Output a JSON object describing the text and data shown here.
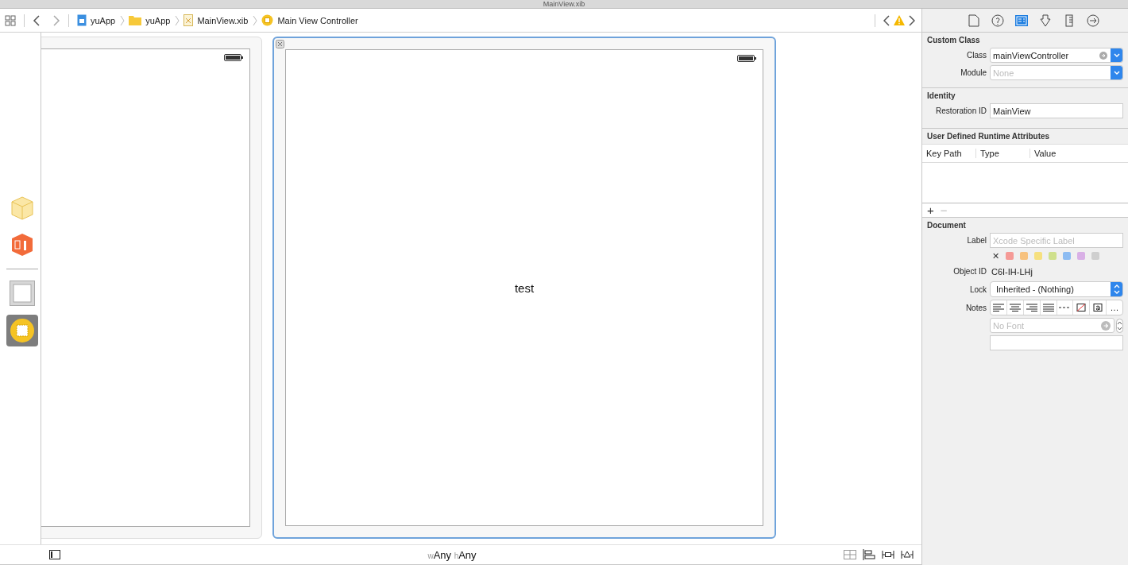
{
  "window": {
    "title": "MainView.xib"
  },
  "jump_bar": [
    {
      "label": "yuApp",
      "kind": "project"
    },
    {
      "label": "yuApp",
      "kind": "folder"
    },
    {
      "label": "MainView.xib",
      "kind": "xib"
    },
    {
      "label": "Main View Controller",
      "kind": "controller"
    }
  ],
  "outline": [
    {
      "kind": "cube",
      "selected": false
    },
    {
      "kind": "responder",
      "selected": false
    },
    {
      "kind": "view",
      "selected": false
    },
    {
      "kind": "controller",
      "selected": true
    }
  ],
  "canvas": {
    "label": "test"
  },
  "size_class": {
    "w_prefix": "w",
    "w_value": "Any",
    "h_prefix": "h",
    "h_value": "Any"
  },
  "inspector_tabs": [
    {
      "kind": "file",
      "selected": false
    },
    {
      "kind": "help",
      "selected": false
    },
    {
      "kind": "identity",
      "selected": true
    },
    {
      "kind": "attributes",
      "selected": false
    },
    {
      "kind": "size",
      "selected": false
    },
    {
      "kind": "connections",
      "selected": false
    }
  ],
  "custom_class": {
    "title": "Custom Class",
    "class_label": "Class",
    "class_value": "mainViewController",
    "module_label": "Module",
    "module_placeholder": "None"
  },
  "identity": {
    "title": "Identity",
    "restoration_label": "Restoration ID",
    "restoration_value": "MainView"
  },
  "runtime_attributes": {
    "title": "User Defined Runtime Attributes",
    "columns": [
      "Key Path",
      "Type",
      "Value"
    ],
    "add": "+",
    "remove": "−"
  },
  "document": {
    "title": "Document",
    "label_label": "Label",
    "label_placeholder": "Xcode Specific Label",
    "clear": "✕",
    "label_colors": [
      {
        "color": "#f59a96"
      },
      {
        "color": "#f7c27f"
      },
      {
        "color": "#f6e07e"
      },
      {
        "color": "#cfe08c"
      },
      {
        "color": "#8dbcf2"
      },
      {
        "color": "#d9b0e6"
      },
      {
        "color": "#cfcfcf"
      }
    ],
    "object_id_label": "Object ID",
    "object_id": "C6I-IH-LHj",
    "lock_label": "Lock",
    "lock_value": "Inherited - (Nothing)",
    "notes_label": "Notes",
    "notes_tools": [
      {
        "kind": "left"
      },
      {
        "kind": "center"
      },
      {
        "kind": "right"
      },
      {
        "kind": "justify"
      },
      {
        "kind": "natural"
      },
      {
        "kind": "color"
      },
      {
        "kind": "font"
      },
      {
        "kind": "more"
      }
    ],
    "more_label": "…",
    "font_placeholder": "No Font"
  }
}
